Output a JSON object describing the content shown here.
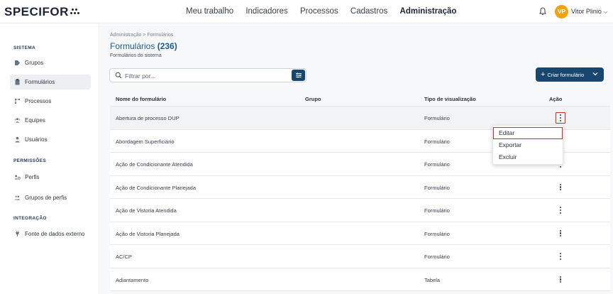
{
  "brand": {
    "name": "SPECIFOR"
  },
  "nav": {
    "items": [
      "Meu trabalho",
      "Indicadores",
      "Processos",
      "Cadastros",
      "Administração"
    ],
    "active": "Administração"
  },
  "user": {
    "initials": "VP",
    "name": "Vitor Plinio",
    "avatar_color": "#f2a20e"
  },
  "sidebar": {
    "sections": [
      {
        "title": "SISTEMA",
        "items": [
          {
            "label": "Grupos",
            "icon": "tag-icon"
          },
          {
            "label": "Formulários",
            "icon": "form-icon",
            "active": true
          },
          {
            "label": "Processos",
            "icon": "process-icon"
          },
          {
            "label": "Equipes",
            "icon": "team-icon"
          },
          {
            "label": "Usuários",
            "icon": "user-icon"
          }
        ]
      },
      {
        "title": "PERMISSÕES",
        "items": [
          {
            "label": "Perfis",
            "icon": "profile-icon"
          },
          {
            "label": "Grupos de perfis",
            "icon": "profile-group-icon"
          }
        ]
      },
      {
        "title": "INTEGRAÇÃO",
        "items": [
          {
            "label": "Fonte de dados externo",
            "icon": "plug-icon"
          }
        ]
      }
    ]
  },
  "page": {
    "breadcrumb": "Administração > Formulários",
    "title": "Formulários",
    "count": "(236)",
    "subtitle": "Formulários do sistema"
  },
  "search": {
    "placeholder": "Filtrar por..."
  },
  "actions": {
    "create_label": "Criar formulário"
  },
  "table": {
    "headers": [
      "Nome do formulário",
      "Grupo",
      "Tipo de visualização",
      "Ação"
    ],
    "rows": [
      {
        "name": "Abertura de processo DUP",
        "group": "",
        "type": "Formulário"
      },
      {
        "name": "Abordagem Superficiário",
        "group": "",
        "type": "Formulário"
      },
      {
        "name": "Ação de Condicionante Atendida",
        "group": "",
        "type": "Formulário"
      },
      {
        "name": "Ação de Condicionante Planejada",
        "group": "",
        "type": "Formulário"
      },
      {
        "name": "Ação de Vistoria Atendida",
        "group": "",
        "type": "Formulário"
      },
      {
        "name": "Ação de Vistoria Planejada",
        "group": "",
        "type": "Formulário"
      },
      {
        "name": "AC/CP",
        "group": "",
        "type": "Formulário"
      },
      {
        "name": "Adiantamento",
        "group": "",
        "type": "Tabela"
      }
    ]
  },
  "context_menu": {
    "items": [
      "Editar",
      "Exportar",
      "Excluir"
    ]
  },
  "colors": {
    "primary": "#17476e",
    "highlight": "#d9262c",
    "title": "#1f5a8a"
  }
}
